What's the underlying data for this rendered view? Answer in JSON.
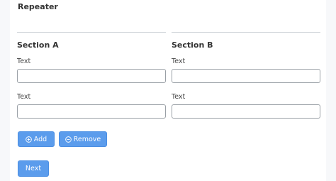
{
  "form": {
    "title": "Repeater"
  },
  "sections": [
    {
      "title": "Section A",
      "fields": [
        {
          "label": "Text",
          "value": ""
        },
        {
          "label": "Text",
          "value": ""
        }
      ]
    },
    {
      "title": "Section B",
      "fields": [
        {
          "label": "Text",
          "value": ""
        },
        {
          "label": "Text",
          "value": ""
        }
      ]
    }
  ],
  "actions": {
    "add_label": "Add",
    "add_icon": "plus-circle-icon",
    "remove_label": "Remove",
    "remove_icon": "minus-circle-icon",
    "next_label": "Next"
  },
  "colors": {
    "button": "#5b9cec",
    "background": "#f7f8fa",
    "card": "#ffffff"
  }
}
